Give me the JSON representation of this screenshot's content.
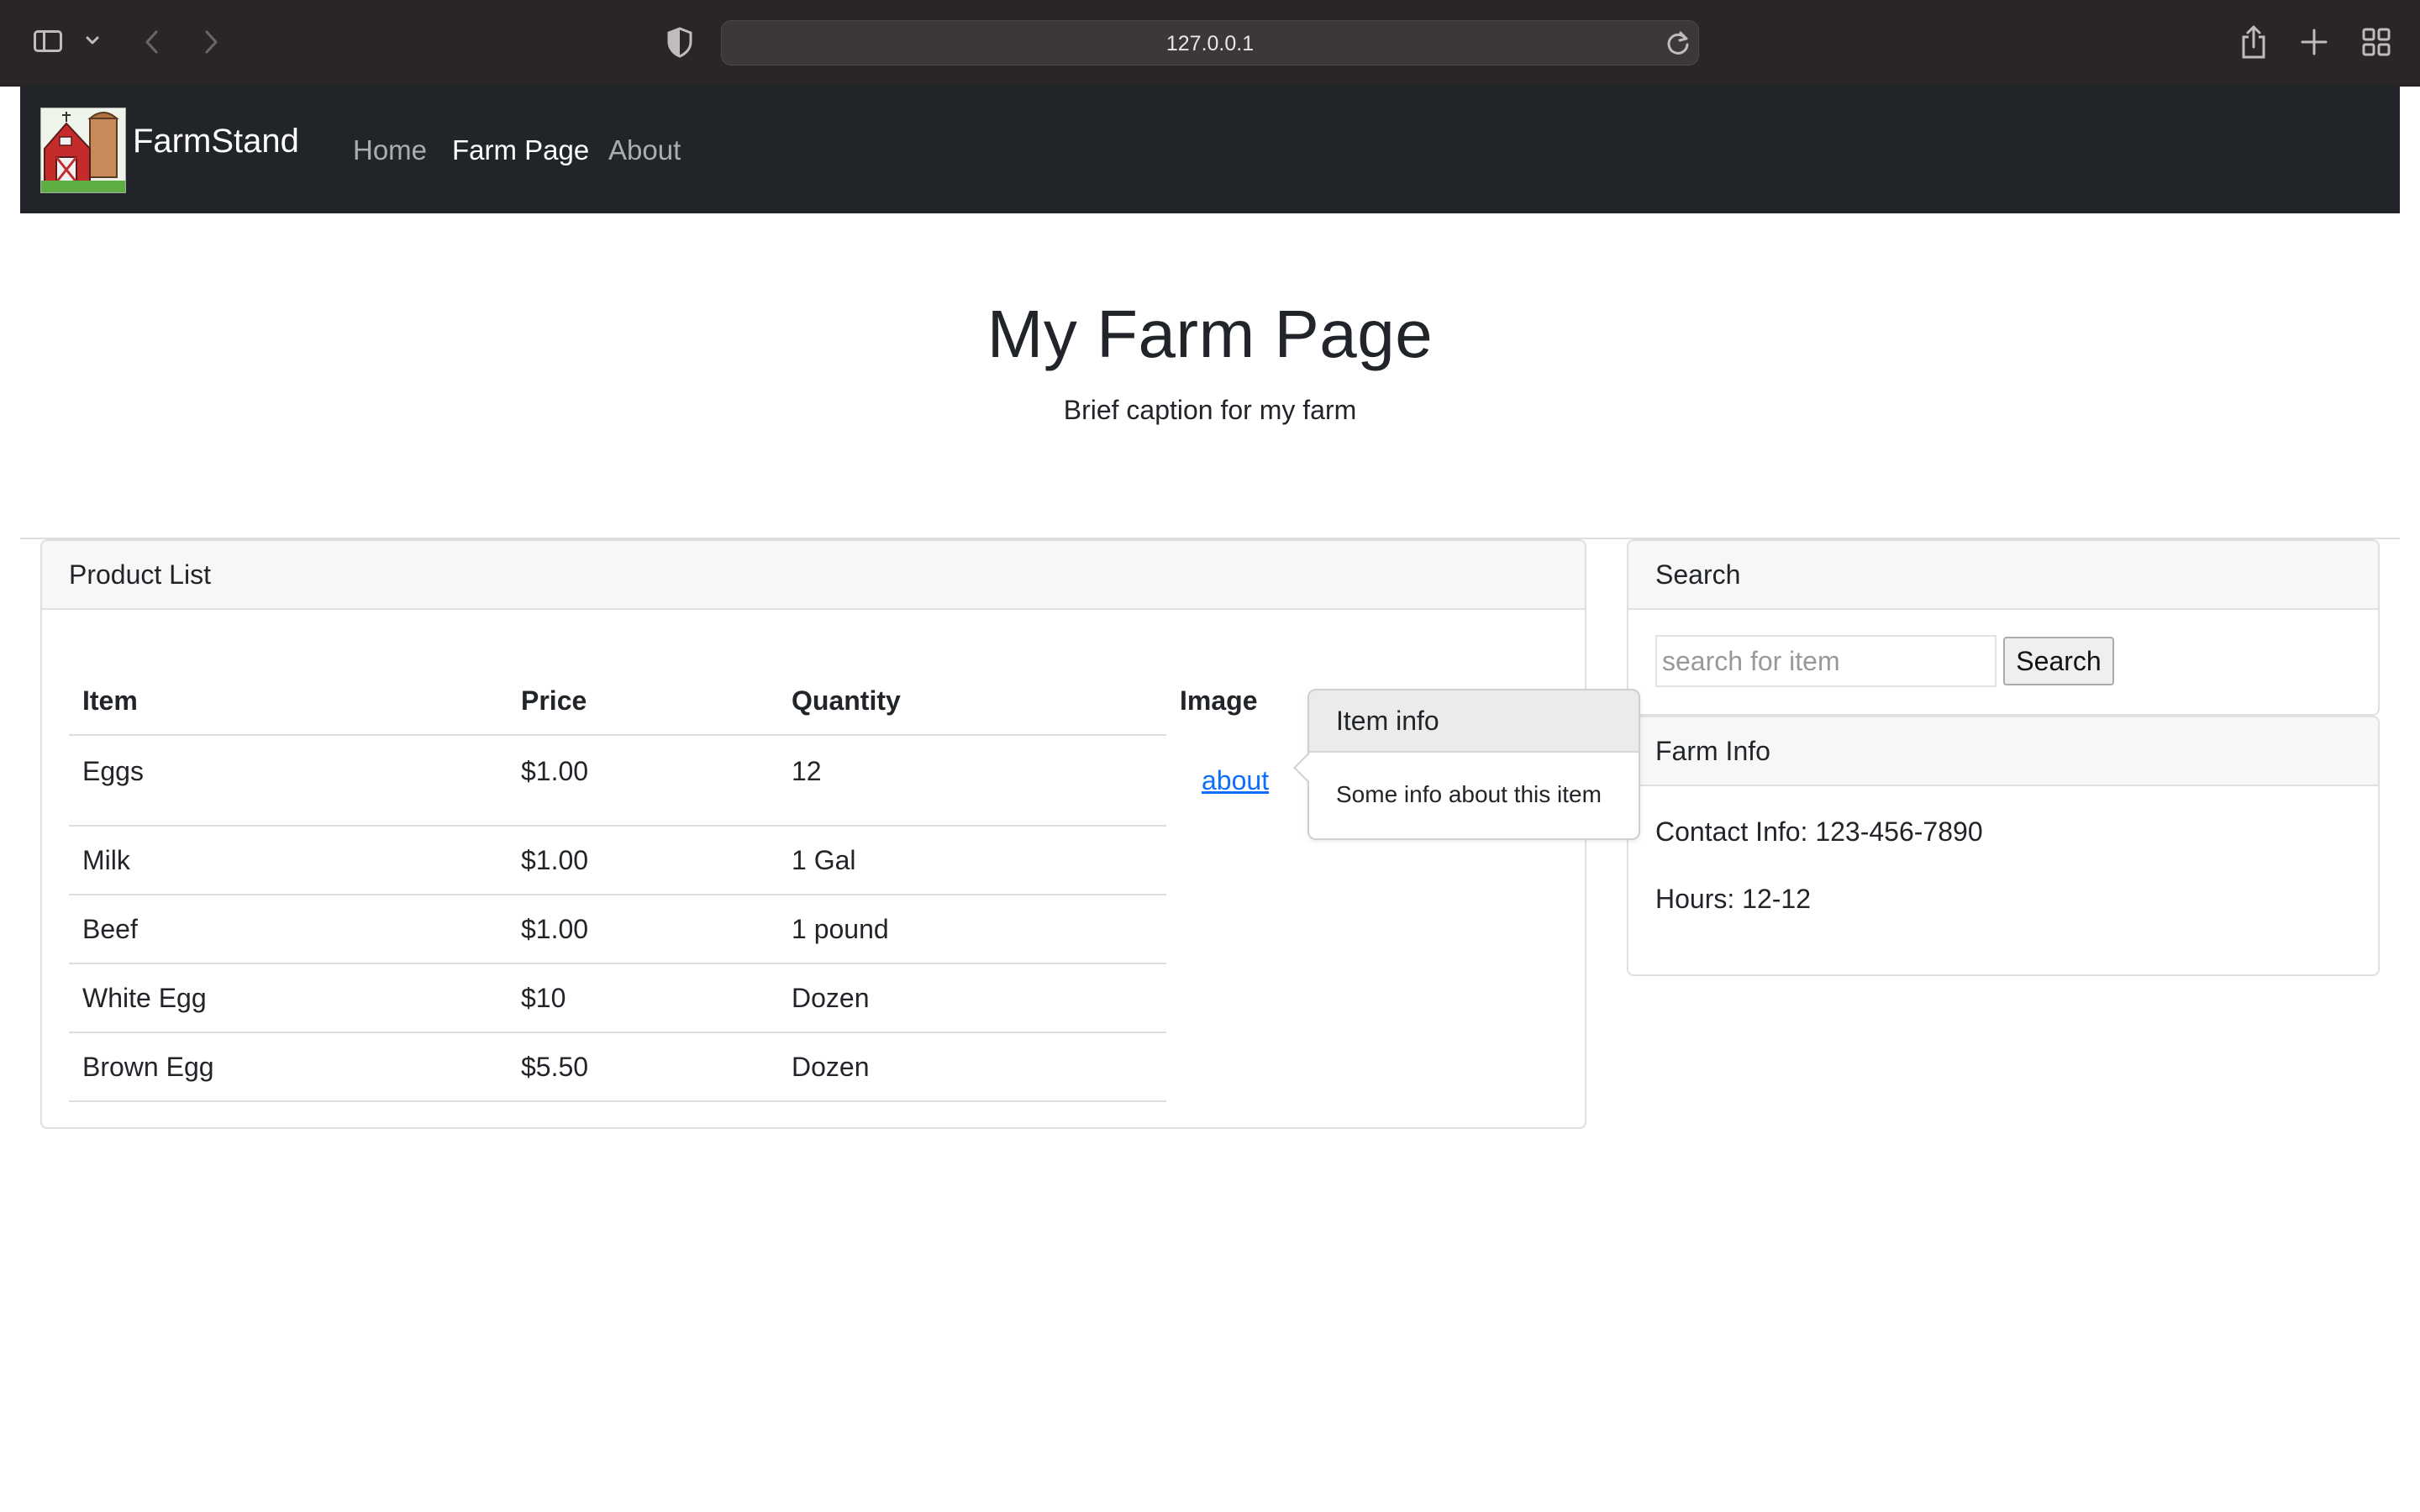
{
  "browser": {
    "url": "127.0.0.1"
  },
  "navbar": {
    "brand": "FarmStand",
    "links": [
      {
        "label": "Home",
        "active": false
      },
      {
        "label": "Farm Page",
        "active": true
      },
      {
        "label": "About",
        "active": false
      }
    ]
  },
  "hero": {
    "title": "My Farm Page",
    "caption": "Brief caption for my farm"
  },
  "product_list": {
    "header": "Product List",
    "columns": [
      "Item",
      "Price",
      "Quantity",
      "Image"
    ],
    "rows": [
      {
        "item": "Eggs",
        "price": "$1.00",
        "quantity": "12",
        "image_link": "about"
      },
      {
        "item": "Milk",
        "price": "$1.00",
        "quantity": "1 Gal"
      },
      {
        "item": "Beef",
        "price": "$1.00",
        "quantity": "1 pound"
      },
      {
        "item": "White Egg",
        "price": "$10",
        "quantity": "Dozen"
      },
      {
        "item": "Brown Egg",
        "price": "$5.50",
        "quantity": "Dozen"
      }
    ]
  },
  "popover": {
    "title": "Item info",
    "body": "Some info about this item"
  },
  "search": {
    "header": "Search",
    "placeholder": "search for item",
    "button_label": "Search"
  },
  "farm_info": {
    "header": "Farm Info",
    "contact": "Contact Info: 123-456-7890",
    "hours": "Hours: 12-12"
  },
  "colors": {
    "navbar_bg": "#212529",
    "link": "#0d6efd",
    "chrome_bg": "#2a2627"
  }
}
